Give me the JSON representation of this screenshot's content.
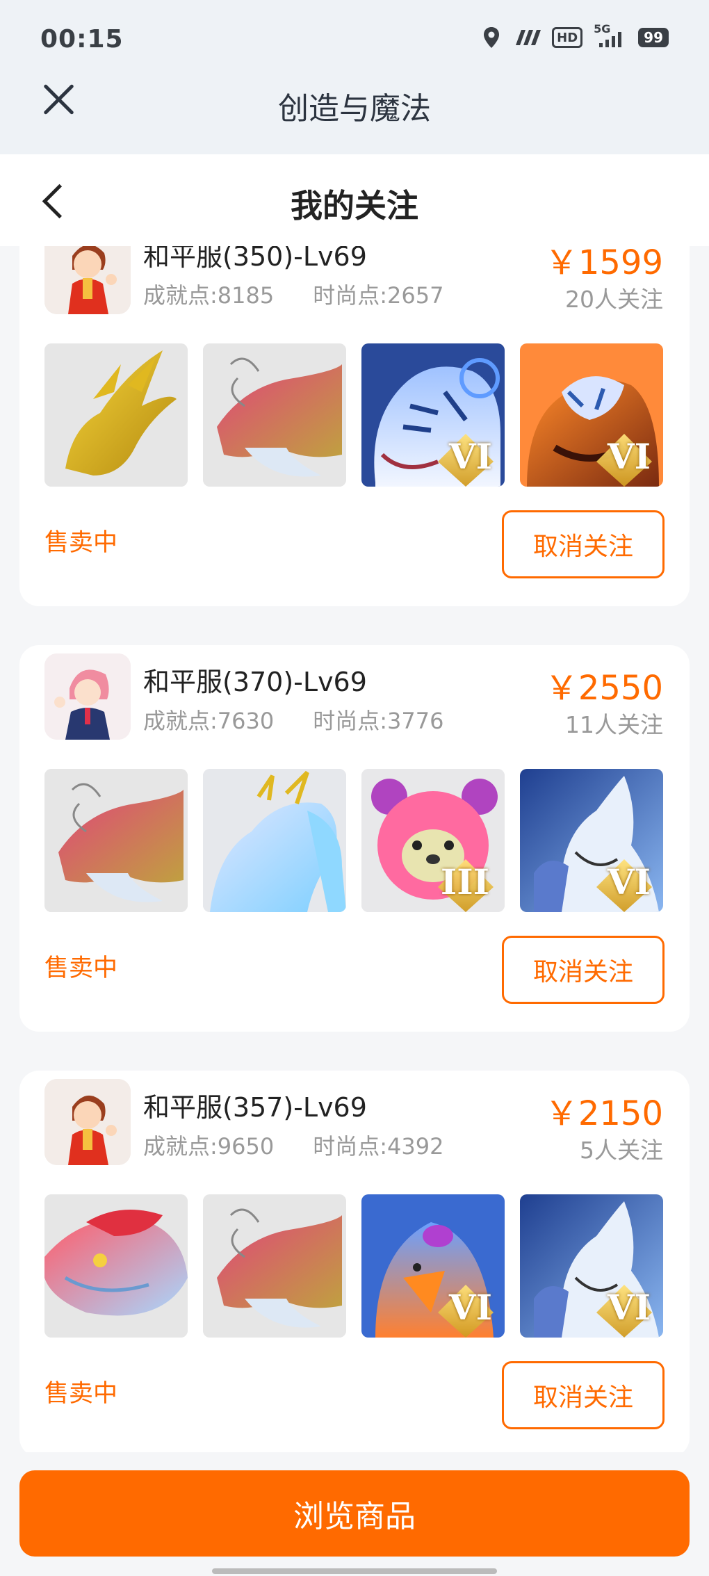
{
  "status_bar": {
    "time": "00:15",
    "icons": [
      "location-icon",
      "wifi-icon",
      "hd-icon",
      "signal-5g-icon",
      "battery-icon"
    ],
    "network_label": "5G",
    "hd_label": "HD",
    "battery_level": "99"
  },
  "app_bar": {
    "title": "创造与魔法",
    "close_icon": "close-icon"
  },
  "page_header": {
    "title": "我的关注",
    "back_icon": "chevron-left-icon"
  },
  "colors": {
    "accent": "#ff6a00",
    "muted_text": "#999999",
    "card_bg": "#ffffff",
    "page_bg": "#f5f6f8"
  },
  "listings": [
    {
      "title": "和平服(350)-Lv69",
      "achievement": "成就点:8185",
      "fashion": "时尚点:2657",
      "price": "￥1599",
      "followers": "20人关注",
      "status": "售卖中",
      "unfollow_label": "取消关注",
      "avatar": "boy-avatar",
      "pets": [
        {
          "name": "golden-dragon",
          "tier": ""
        },
        {
          "name": "red-dragon",
          "tier": ""
        },
        {
          "name": "white-tiger",
          "tier": "VI"
        },
        {
          "name": "lion-mask",
          "tier": "VI"
        }
      ]
    },
    {
      "title": "和平服(370)-Lv69",
      "achievement": "成就点:7630",
      "fashion": "时尚点:3776",
      "price": "￥2550",
      "followers": "11人关注",
      "status": "售卖中",
      "unfollow_label": "取消关注",
      "avatar": "girl-avatar",
      "pets": [
        {
          "name": "red-dragon",
          "tier": ""
        },
        {
          "name": "ice-horse",
          "tier": ""
        },
        {
          "name": "pink-bear",
          "tier": "III"
        },
        {
          "name": "ice-griffin",
          "tier": "VI"
        }
      ]
    },
    {
      "title": "和平服(357)-Lv69",
      "achievement": "成就点:9650",
      "fashion": "时尚点:4392",
      "price": "￥2150",
      "followers": "5人关注",
      "status": "售卖中",
      "unfollow_label": "取消关注",
      "avatar": "boy-avatar",
      "pets": [
        {
          "name": "sky-whale",
          "tier": ""
        },
        {
          "name": "red-dragon",
          "tier": ""
        },
        {
          "name": "fire-eagle",
          "tier": "VI"
        },
        {
          "name": "ice-griffin",
          "tier": "VI"
        }
      ]
    }
  ],
  "footer": {
    "browse_label": "浏览商品"
  }
}
